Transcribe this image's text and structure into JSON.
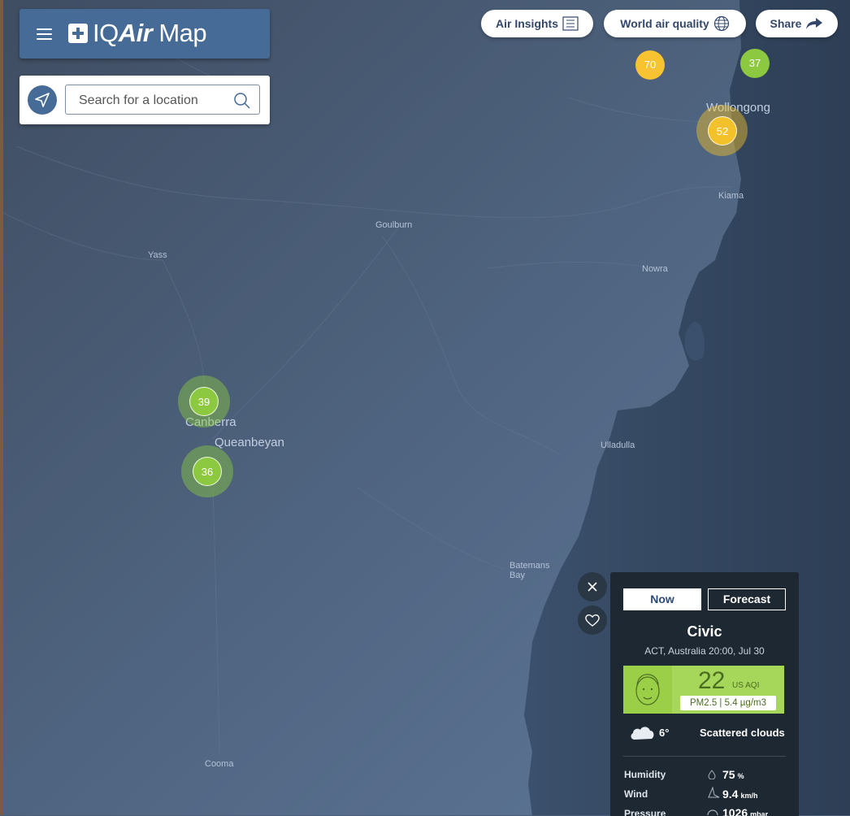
{
  "brand": {
    "iq": "IQ",
    "air": "Air",
    "map": "Map"
  },
  "search": {
    "placeholder": "Search for a location"
  },
  "top_buttons": {
    "air_insights": "Air Insights",
    "world_air_quality": "World air quality",
    "share": "Share"
  },
  "markers": [
    {
      "value": "70",
      "color": "#f7c331"
    },
    {
      "value": "37",
      "color": "#8cc940"
    },
    {
      "value": "52",
      "color": "#f3c129"
    },
    {
      "value": "39",
      "color": "#8cc940"
    },
    {
      "value": "36",
      "color": "#8cc940"
    }
  ],
  "places": {
    "wollongong": "Wollongong",
    "kiama": "Kiama",
    "goulburn": "Goulburn",
    "yass": "Yass",
    "nowra": "Nowra",
    "canberra": "Canberra",
    "queanbeyan": "Queanbeyan",
    "ulladulla": "Ulladulla",
    "batemans_bay": "Batemans Bay",
    "cooma": "Cooma"
  },
  "popup": {
    "tab_now": "Now",
    "tab_forecast": "Forecast",
    "city": "Civic",
    "subtitle": "ACT, Australia 20:00, Jul 30",
    "aqi": "22",
    "aqi_unit": "US AQI",
    "pollutant": "PM2.5 | 5.4 µg/m3",
    "temperature": "6°",
    "weather": "Scattered clouds",
    "humidity_label": "Humidity",
    "humidity_value": "75",
    "humidity_unit": "%",
    "wind_label": "Wind",
    "wind_value": "9.4",
    "wind_unit": "km/h",
    "pressure_label": "Pressure",
    "pressure_value": "1026",
    "pressure_unit": "mbar"
  },
  "colors": {
    "header": "#456b96",
    "popup_bg": "#1d2833",
    "aqi_good": "#a6d65a"
  }
}
